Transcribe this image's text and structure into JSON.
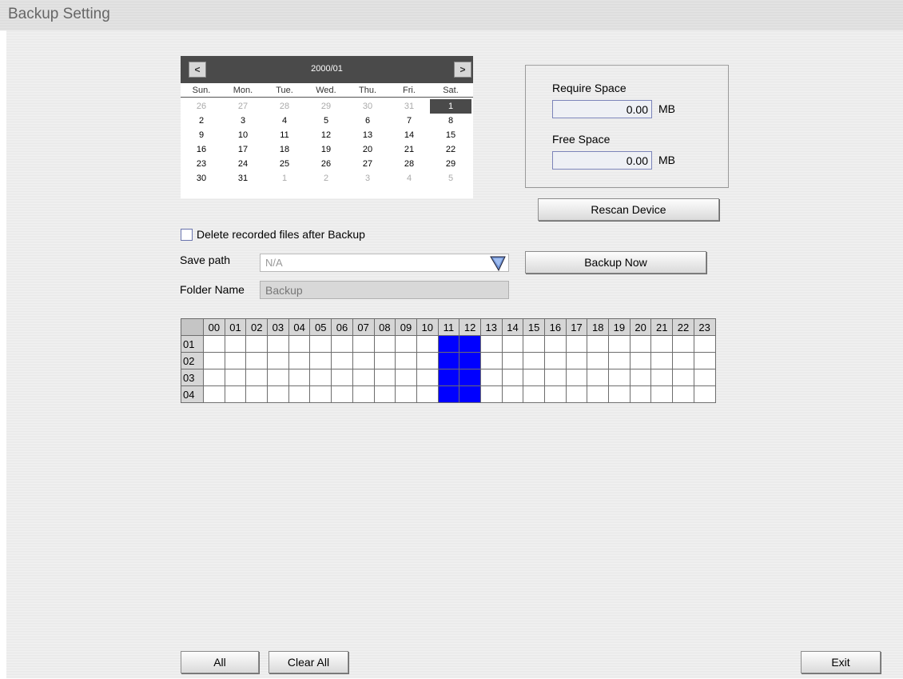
{
  "window": {
    "title": "Backup Setting"
  },
  "calendar": {
    "month": "2000/01",
    "prev": "<",
    "next": ">",
    "weekdays": [
      "Sun.",
      "Mon.",
      "Tue.",
      "Wed.",
      "Thu.",
      "Fri.",
      "Sat."
    ],
    "weeks": [
      [
        "26",
        "27",
        "28",
        "29",
        "30",
        "31",
        "1"
      ],
      [
        "2",
        "3",
        "4",
        "5",
        "6",
        "7",
        "8"
      ],
      [
        "9",
        "10",
        "11",
        "12",
        "13",
        "14",
        "15"
      ],
      [
        "16",
        "17",
        "18",
        "19",
        "20",
        "21",
        "22"
      ],
      [
        "23",
        "24",
        "25",
        "26",
        "27",
        "28",
        "29"
      ],
      [
        "30",
        "31",
        "1",
        "2",
        "3",
        "4",
        "5"
      ]
    ],
    "selected_day": "1"
  },
  "space": {
    "require_label": "Require Space",
    "require_value": "0.00",
    "free_label": "Free Space",
    "free_value": "0.00",
    "unit": "MB"
  },
  "buttons": {
    "rescan": "Rescan Device",
    "backup_now": "Backup Now",
    "all": "All",
    "clear_all": "Clear All",
    "exit": "Exit"
  },
  "options": {
    "delete_after_backup": "Delete recorded files after Backup",
    "delete_checked": false,
    "save_path_label": "Save path",
    "save_path_value": "N/A",
    "folder_name_label": "Folder Name",
    "folder_name_value": "Backup"
  },
  "schedule": {
    "hours": [
      "00",
      "01",
      "02",
      "03",
      "04",
      "05",
      "06",
      "07",
      "08",
      "09",
      "10",
      "11",
      "12",
      "13",
      "14",
      "15",
      "16",
      "17",
      "18",
      "19",
      "20",
      "21",
      "22",
      "23"
    ],
    "rows": [
      "01",
      "02",
      "03",
      "04"
    ],
    "selected_hours": [
      "11",
      "12"
    ],
    "selected_color": "#0000ff"
  }
}
